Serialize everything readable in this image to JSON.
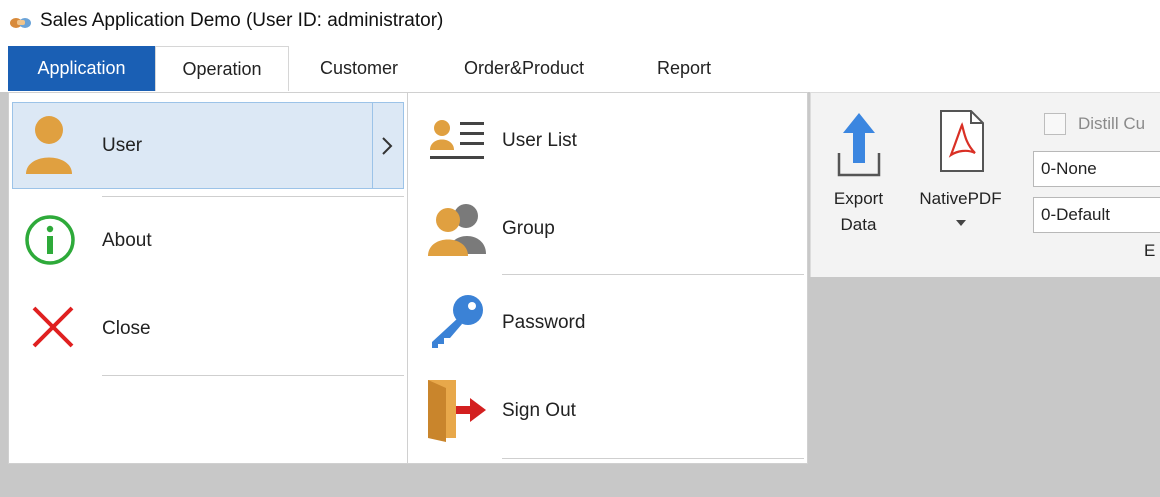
{
  "window": {
    "title": "Sales Application Demo (User ID: administrator)",
    "icon": "handshake-icon"
  },
  "menu_tabs": [
    {
      "label": "Application",
      "active": true
    },
    {
      "label": "Operation",
      "active": false
    },
    {
      "label": "Customer",
      "active": false
    },
    {
      "label": "Order&Product",
      "active": false
    },
    {
      "label": "Report",
      "active": false
    }
  ],
  "application_menu": {
    "items": [
      {
        "label": "User",
        "icon": "user-icon",
        "selected": true,
        "has_submenu": true
      },
      {
        "label": "About",
        "icon": "info-icon"
      },
      {
        "label": "Close",
        "icon": "close-icon"
      }
    ]
  },
  "user_submenu": {
    "items": [
      {
        "label": "User List",
        "icon": "user-list-icon"
      },
      {
        "label": "Group",
        "icon": "group-icon"
      },
      {
        "label": "Password",
        "icon": "key-icon"
      },
      {
        "label": "Sign Out",
        "icon": "sign-out-icon"
      }
    ]
  },
  "ribbon": {
    "export_data_line1": "Export",
    "export_data_line2": "Data",
    "native_pdf_label": "NativePDF",
    "distill_label": "Distill Cu",
    "combo1_value": "0-None",
    "combo2_value": "0-Default",
    "group_label_fragment": "E"
  },
  "colors": {
    "accent": "#1a5fb4",
    "selection_bg": "#dce8f5",
    "workspace": "#c8c8c8",
    "user_icon": "#e0a040",
    "key_icon": "#3b82d6",
    "info_icon": "#2eaa3a",
    "close_icon": "#e02020"
  }
}
